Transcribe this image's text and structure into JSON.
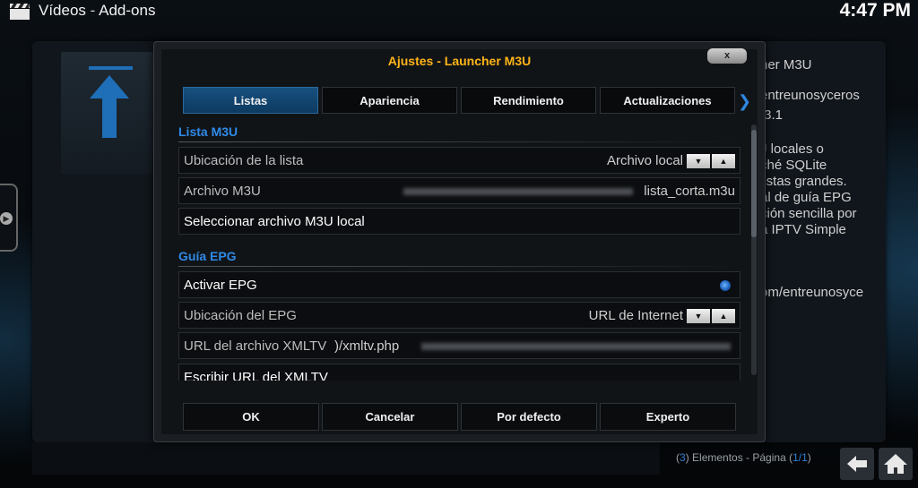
{
  "topbar": {
    "section": "Vídeos",
    "separator": "-",
    "subsection": "Add-ons",
    "clock": "4:47 PM"
  },
  "background": {
    "info_lines": [
      "her M3U",
      "entreunosyceros",
      ".3.1",
      "J locales o",
      "ché SQLite",
      "listas grandes.",
      "al de guía EPG",
      "ción sencilla por",
      "a IPTV Simple",
      "om/entreunosyce"
    ],
    "footer": {
      "count_open": "(",
      "count": "3",
      "count_close": ") Elementos - Página (",
      "page": "1/1",
      "page_close": ")"
    }
  },
  "dialog": {
    "title": "Ajustes - Launcher M3U",
    "close_label": "x",
    "tabs": [
      {
        "label": "Listas",
        "active": true
      },
      {
        "label": "Apariencia",
        "active": false
      },
      {
        "label": "Rendimiento",
        "active": false
      },
      {
        "label": "Actualizaciones",
        "active": false
      }
    ],
    "more_tabs_icon": "chevron-right-icon",
    "sections": {
      "m3u": {
        "header": "Lista M3U",
        "location_label": "Ubicación de la lista",
        "location_value": "Archivo local",
        "file_label": "Archivo M3U",
        "file_value": "lista_corta.m3u",
        "select_label": "Seleccionar archivo M3U local"
      },
      "epg": {
        "header": "Guía EPG",
        "activate_label": "Activar EPG",
        "activate_on": true,
        "location_label": "Ubicación del EPG",
        "location_value": "URL de Internet",
        "url_label": "URL del archivo XMLTV",
        "url_value": ")/xmltv.php",
        "write_url_label": "Escribir URL del XMLTV"
      }
    },
    "buttons": {
      "ok": "OK",
      "cancel": "Cancelar",
      "default": "Por defecto",
      "expert": "Experto"
    }
  },
  "colors": {
    "accent_title": "#ffb418",
    "section_header": "#2f8ae8",
    "active_tab": "#17507e"
  }
}
